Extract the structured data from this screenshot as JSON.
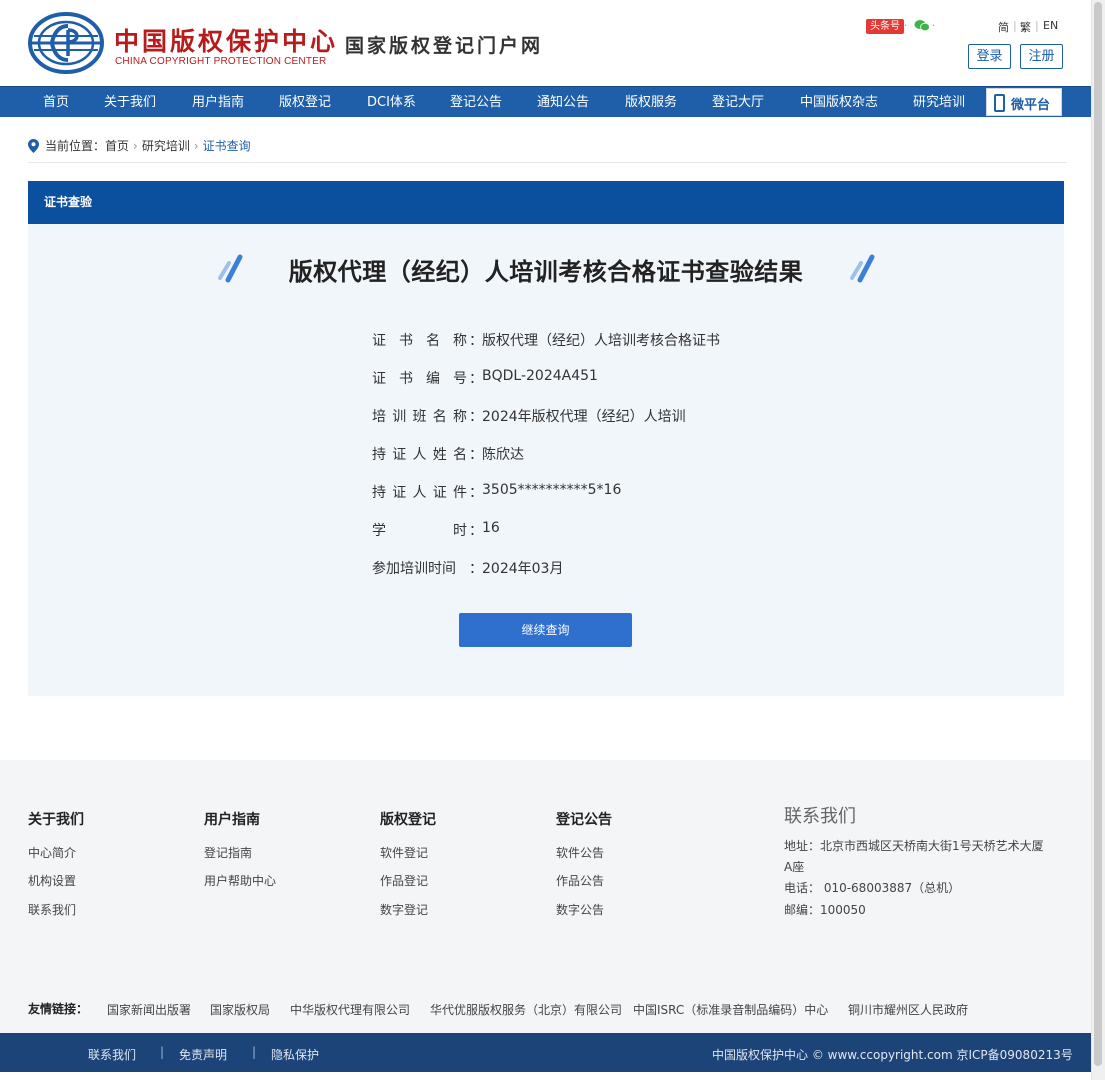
{
  "header": {
    "logo_cn": "中国版权保护中心",
    "logo_en": "CHINA COPYRIGHT PROTECTION CENTER",
    "portal_title": "国家版权登记门户网",
    "toutiao_badge": "头条号",
    "lang_simplified": "简",
    "lang_traditional": "繁",
    "lang_en": "EN",
    "login_label": "登录",
    "register_label": "注册"
  },
  "nav": {
    "items": [
      "首页",
      "关于我们",
      "用户指南",
      "版权登记",
      "DCI体系",
      "登记公告",
      "通知公告",
      "版权服务",
      "登记大厅",
      "中国版权杂志",
      "研究培训"
    ],
    "micro_platform": "微平台"
  },
  "breadcrumb": {
    "prefix": "当前位置：",
    "home": "首页",
    "section": "研究培训",
    "current": "证书查询"
  },
  "panel": {
    "header": "证书查验",
    "title": "版权代理（经纪）人培训考核合格证书查验结果",
    "rows": [
      {
        "label": [
          "证",
          "书",
          "名",
          "称"
        ],
        "value": "版权代理（经纪）人培训考核合格证书"
      },
      {
        "label": [
          "证",
          "书",
          "编",
          "号"
        ],
        "value": "BQDL-2024A451"
      },
      {
        "label": [
          "培",
          "训",
          "班",
          "名",
          "称"
        ],
        "value": "2024年版权代理（经纪）人培训"
      },
      {
        "label": [
          "持",
          "证",
          "人",
          "姓",
          "名"
        ],
        "value": "陈欣达"
      },
      {
        "label": [
          "持",
          "证",
          "人",
          "证",
          "件"
        ],
        "value": "3505**********5*16"
      },
      {
        "label": [
          "学",
          "时"
        ],
        "value": "16"
      },
      {
        "label": [
          "参加培训时间"
        ],
        "value": "2024年03月"
      }
    ],
    "colon": "：",
    "continue_button": "继续查询"
  },
  "footer": {
    "columns": [
      {
        "title": "关于我们",
        "links": [
          "中心简介",
          "机构设置",
          "联系我们"
        ]
      },
      {
        "title": "用户指南",
        "links": [
          "登记指南",
          "用户帮助中心"
        ]
      },
      {
        "title": "版权登记",
        "links": [
          "软件登记",
          "作品登记",
          "数字登记"
        ]
      },
      {
        "title": "登记公告",
        "links": [
          "软件公告",
          "作品公告",
          "数字公告"
        ]
      }
    ],
    "contact": {
      "title": "联系我们",
      "address": "地址：北京市西城区天桥南大街1号天桥艺术大厦A座",
      "phone": "电话： 010-68003887（总机）",
      "postcode": "邮编：100050"
    },
    "friend_label": "友情链接：",
    "friend_links": [
      "国家新闻出版署",
      "国家版权局",
      "中华版权代理有限公司",
      "华代优服版权服务（北京）有限公司",
      "中国ISRC（标准录音制品编码）中心",
      "铜川市耀州区人民政府"
    ],
    "bottom_links": [
      "联系我们",
      "免责声明",
      "隐私保护"
    ],
    "bottom_sep": "|",
    "copyright": "中国版权保护中心 © www.ccopyright.com 京ICP备09080213号"
  },
  "colors": {
    "nav_blue": "#1f5ea8",
    "panel_header_blue": "#0b4f9f",
    "brand_red": "#b71c1c",
    "button_blue": "#2f6fce",
    "bottom_bar": "#1c4478"
  }
}
